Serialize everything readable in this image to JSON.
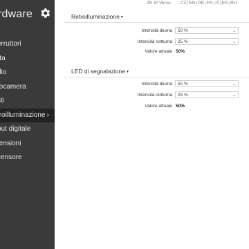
{
  "sidebar": {
    "title": "rdware",
    "items": [
      {
        "label": "erruttori",
        "active": false
      },
      {
        "label": "rta",
        "active": false
      },
      {
        "label": "dio",
        "active": false
      },
      {
        "label": "tocamera",
        "active": false
      },
      {
        "label": "sti",
        "active": false
      },
      {
        "label": "troilluminazione",
        "active": true
      },
      {
        "label": "out digitale",
        "active": false
      },
      {
        "label": "tensioni",
        "active": false
      },
      {
        "label": "censore",
        "active": false
      }
    ]
  },
  "topbar": {
    "model": "2N IP Verso",
    "languages": [
      "CZ",
      "EN",
      "DE",
      "FR",
      "IT",
      "ES",
      "RU"
    ]
  },
  "sections": [
    {
      "title": "Retroilluminazione",
      "rows": [
        {
          "label": "Intensità diurna",
          "value": "50 %"
        },
        {
          "label": "Intensità notturna",
          "value": "25 %"
        }
      ],
      "current_label": "Valore attuale",
      "current_value": "50%"
    },
    {
      "title": "LED di segnalazione",
      "rows": [
        {
          "label": "Intensità diurna",
          "value": "50 %"
        },
        {
          "label": "Intensità notturna",
          "value": "25 %"
        }
      ],
      "current_label": "Valore attuale",
      "current_value": "50%"
    }
  ]
}
